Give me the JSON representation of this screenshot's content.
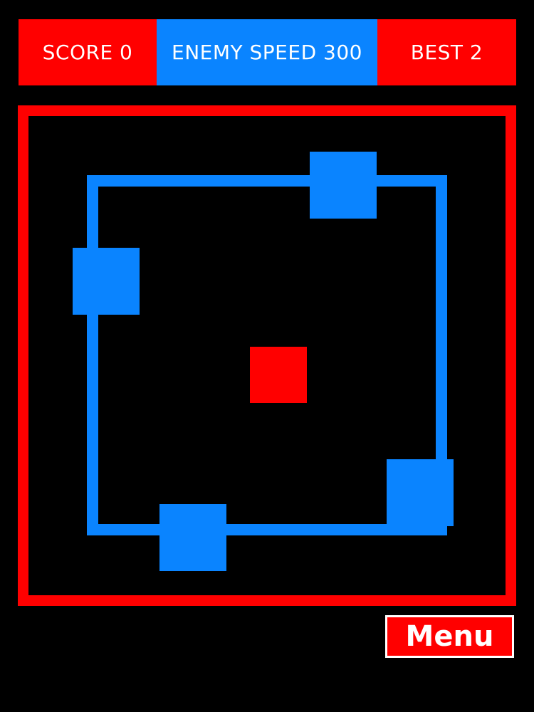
{
  "hud": {
    "score_text": "SCORE 0",
    "speed_text": "ENEMY SPEED 300",
    "best_text": "BEST 2",
    "score_color": "#ff0000",
    "speed_color": "#0a84ff",
    "best_color": "#ff0000"
  },
  "game": {
    "score": 0,
    "enemy_speed": 300,
    "best": 2,
    "enemy_count": 4,
    "colors": {
      "background": "#000000",
      "arena_border": "#ff0000",
      "track": "#0a84ff",
      "enemy": "#0a84ff",
      "player": "#ff0000"
    }
  },
  "menu": {
    "label": "Menu",
    "color": "#ff0000"
  }
}
